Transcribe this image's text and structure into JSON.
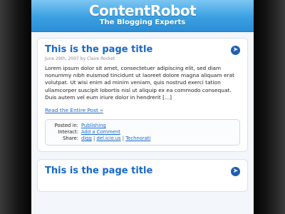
{
  "header": {
    "site_title": "ContentRobot",
    "tagline": "The Blogging Experts"
  },
  "post": {
    "title": "This is the page title",
    "meta": "June 29th, 2007 by Claire Rocket",
    "body": "Lorem ipsum dolor sit amet, consectetuer adipiscing elit, sed diam nonummy nibh euismod tincidunt ut laoreet dolore magna aliquam erat volutpat. Ut wisi enim ad minim veniam, quis nostrud exerci tation ullamcorper suscipit lobortis nisl ut aliquip ex ea commodo consequat. Duis autem vel eum iriure dolor in hendrerit [...]",
    "read_more": "Read the Entire Post »",
    "posted_in_label": "Posted in:",
    "posted_in_value": "Publishing",
    "interact_label": "Interact:",
    "interact_value": "Add a Comment",
    "share_label": "Share:",
    "share_links": [
      "digg",
      "del.icio.us",
      "Technorati"
    ],
    "share_sep": "|"
  },
  "post2": {
    "title": "This is the page title"
  },
  "icons": {
    "arrow": "arrow-circle-icon"
  }
}
